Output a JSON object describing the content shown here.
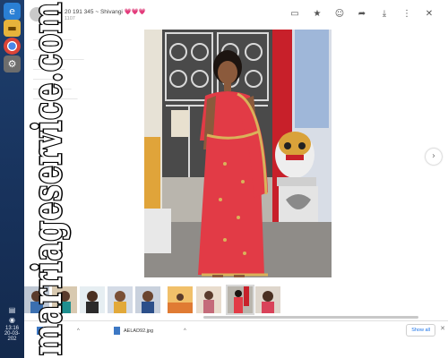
{
  "taskbar": {
    "icons": [
      "ie-icon",
      "folder-icon",
      "chrome-icon",
      "settings-icon"
    ],
    "time": "13:16",
    "date": "20-03-202"
  },
  "viewer": {
    "title_prefix": "20 191 345 ~ Shivangi",
    "title_hearts": "💗💗💗",
    "subtitle": "1107",
    "actions": [
      "comment-icon",
      "star-icon",
      "emoji-icon",
      "forward-icon",
      "download-icon",
      "more-icon",
      "close-icon"
    ]
  },
  "downloads": {
    "file1": "",
    "file2": "AELAD92.jpg",
    "show_all": "Show all"
  },
  "watermark": "marriageservice.com",
  "colors": {
    "taskbar": "#1e3f6e",
    "saree": "#e23b46",
    "border_gold": "#d9b25a",
    "pillar_red": "#c8202a"
  }
}
